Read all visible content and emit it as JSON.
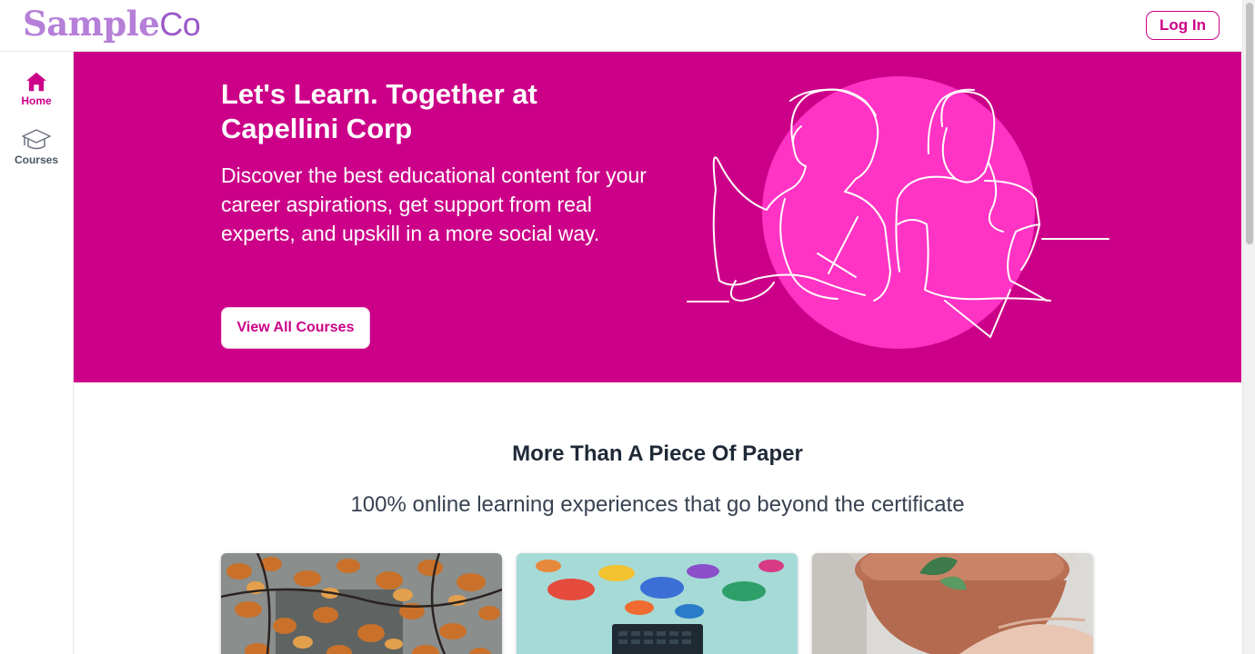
{
  "header": {
    "logo_sample": "Sample",
    "logo_co": "Co",
    "login_label": "Log In"
  },
  "sidebar": {
    "items": [
      {
        "label": "Home",
        "icon": "home-icon",
        "active": true
      },
      {
        "label": "Courses",
        "icon": "graduation-cap-icon",
        "active": false
      }
    ]
  },
  "hero": {
    "title": "Let's Learn. Together at Capellini Corp",
    "description": "Discover the best educational content for your career aspirations, get support from real experts, and upskill in a more social way.",
    "button_label": "View All Courses"
  },
  "section": {
    "title": "More Than A Piece Of Paper",
    "subtitle": "100% online learning experiences that go beyond the certificate"
  },
  "colors": {
    "brand": "#cc0088",
    "hero_circle": "#ff33c4",
    "logo": "#b57fd8"
  }
}
